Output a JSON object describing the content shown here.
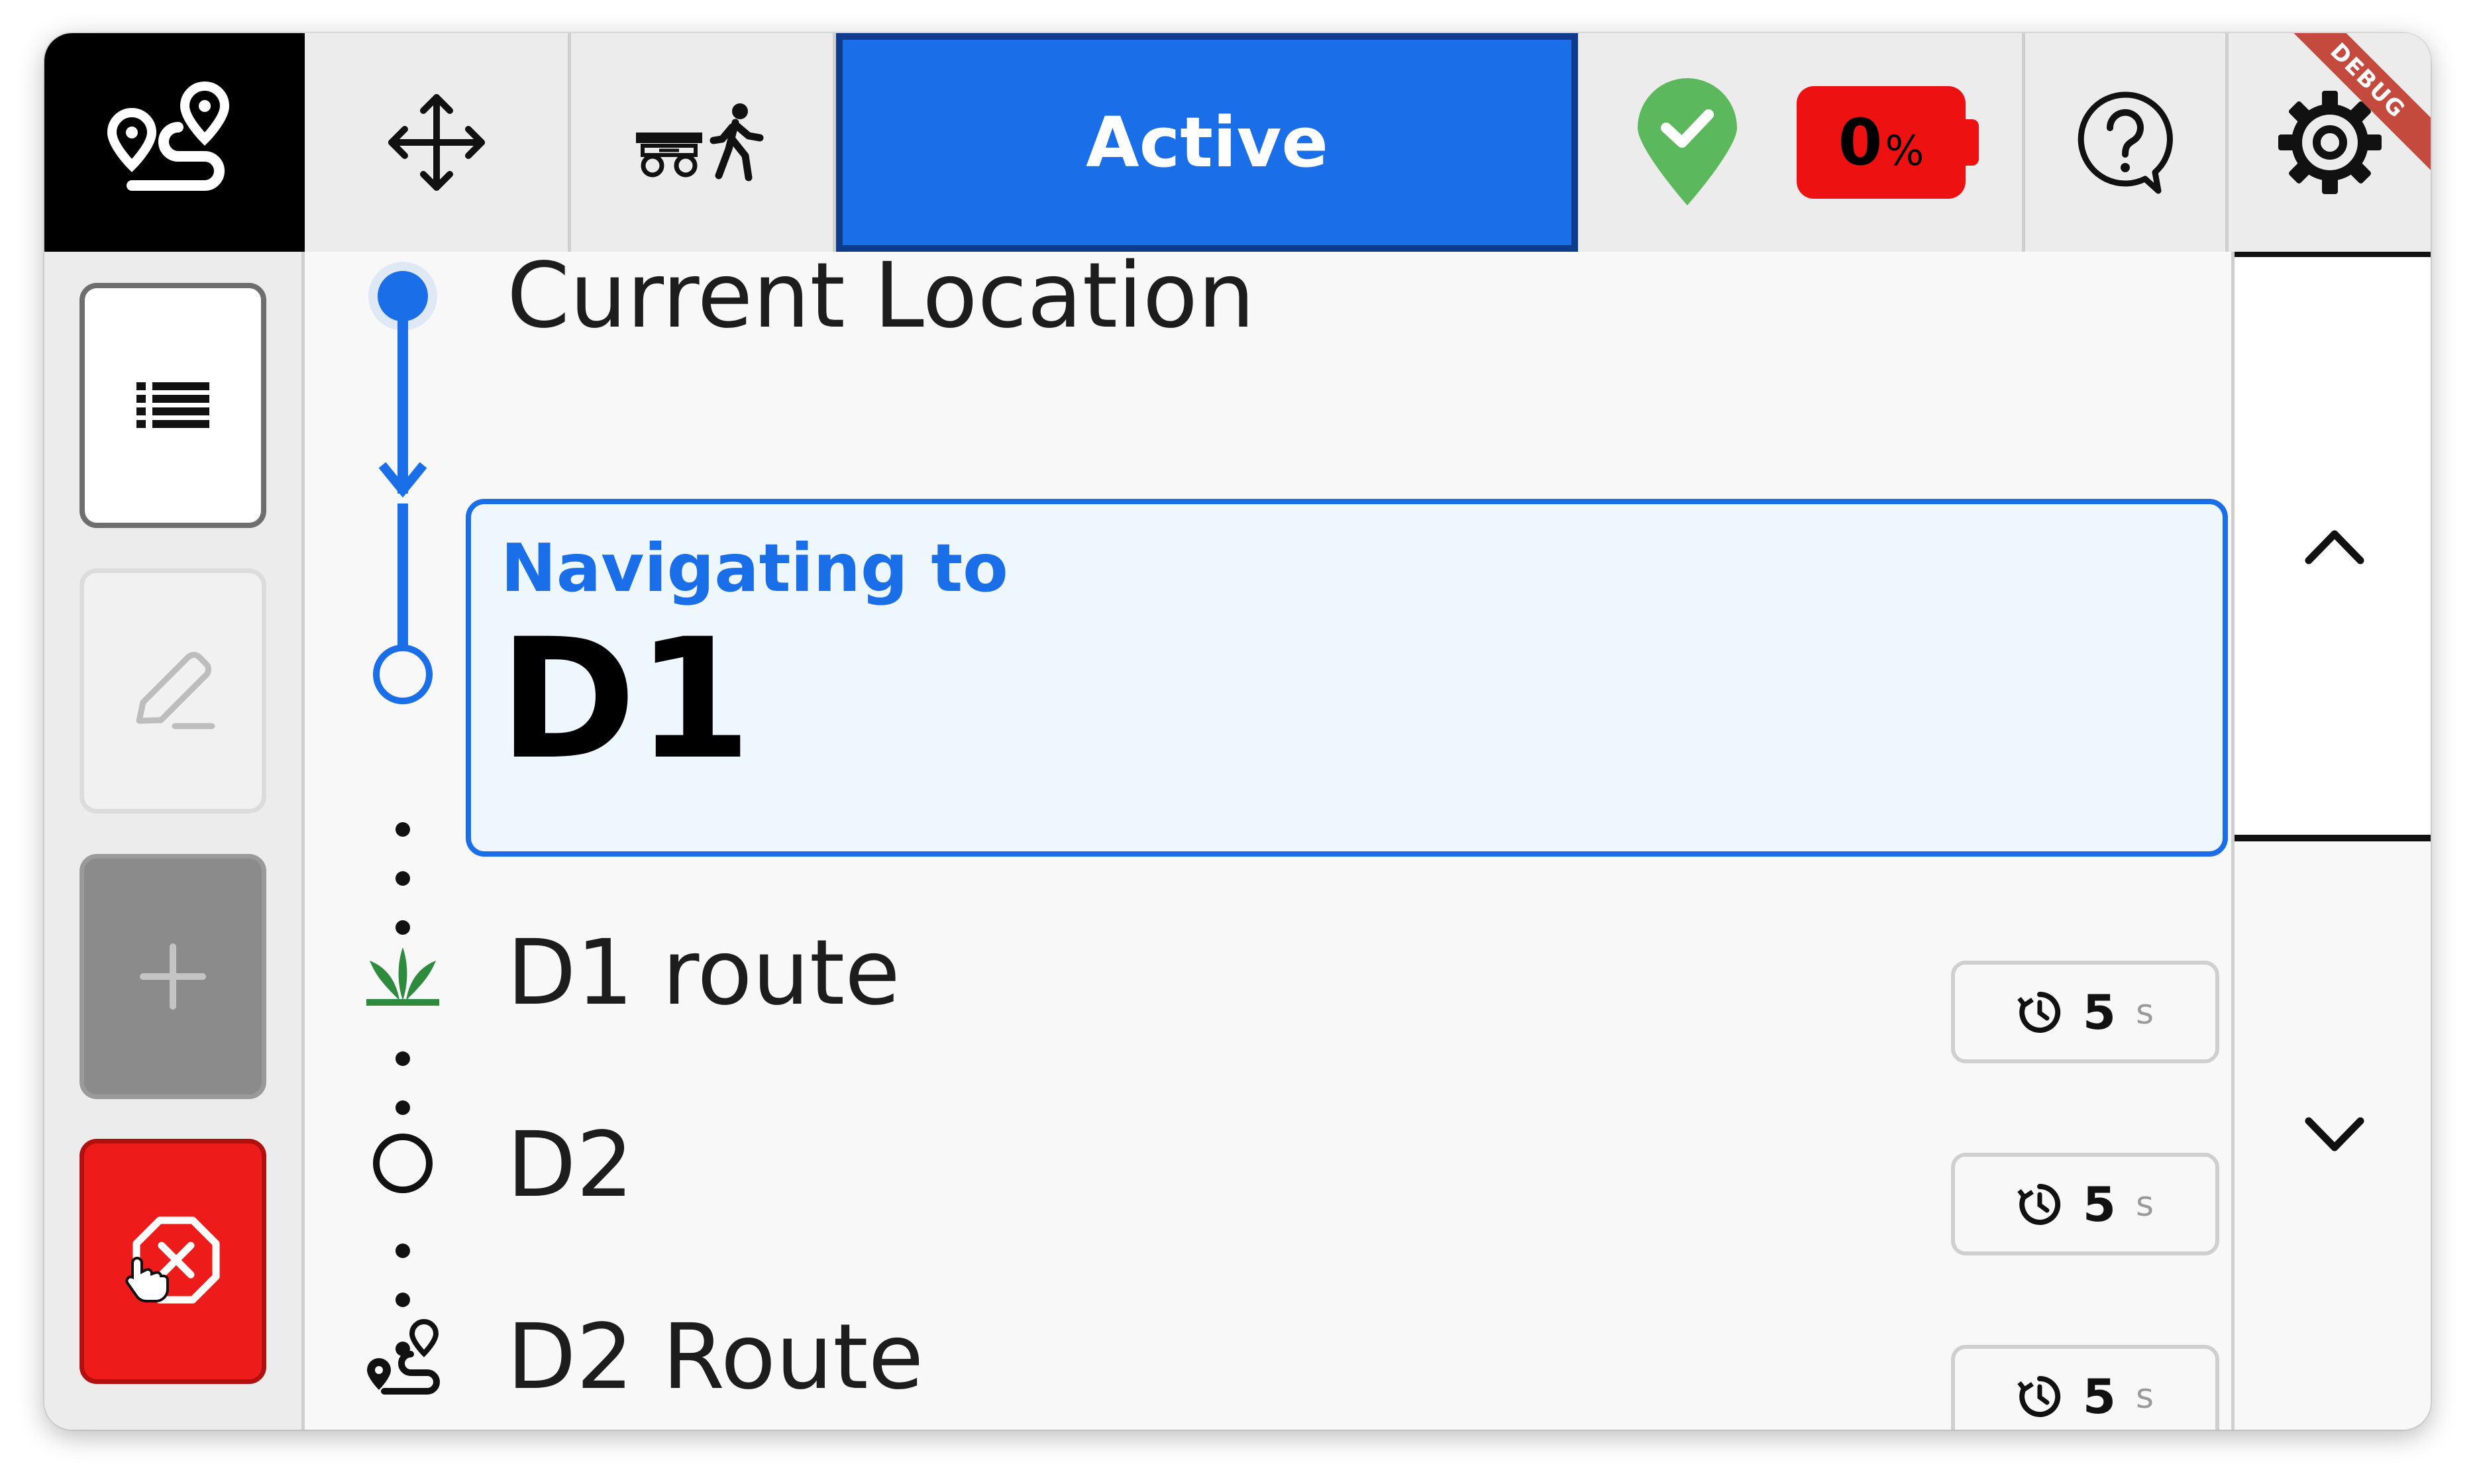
{
  "topbar": {
    "logo_icon": "route-icon",
    "move_icon": "move-arrows-icon",
    "mode_icon": "robot-follow-person-icon",
    "status_label": "Active",
    "connection_icon": "location-check-icon",
    "battery": {
      "value": "0",
      "unit": "%",
      "color": "#ee1111"
    },
    "help_icon": "help-bubble-icon",
    "settings_icon": "gear-icon",
    "debug_label": "DEBUG"
  },
  "sidebar": {
    "list_icon": "list-icon",
    "edit_icon": "edit-pencil-icon",
    "add_icon": "plus-icon",
    "stop_icon": "stop-cancel-icon"
  },
  "route": {
    "current_location": "Current Location",
    "navigating_label": "Navigating to",
    "navigating_destination": "D1",
    "items": [
      {
        "title": "D1 route",
        "icon": "plant-icon",
        "duration": "5",
        "unit": "s"
      },
      {
        "title": "D2",
        "icon": "waypoint-circle-icon",
        "duration": "5",
        "unit": "s"
      },
      {
        "title": "D2 Route",
        "icon": "route-icon",
        "duration": "5",
        "unit": "s"
      }
    ]
  },
  "scroll": {
    "up_icon": "chevron-up-icon",
    "down_icon": "chevron-down-icon"
  },
  "colors": {
    "accent": "#1a6ee8",
    "danger": "#ee1b1b",
    "success": "#5cb85c"
  }
}
